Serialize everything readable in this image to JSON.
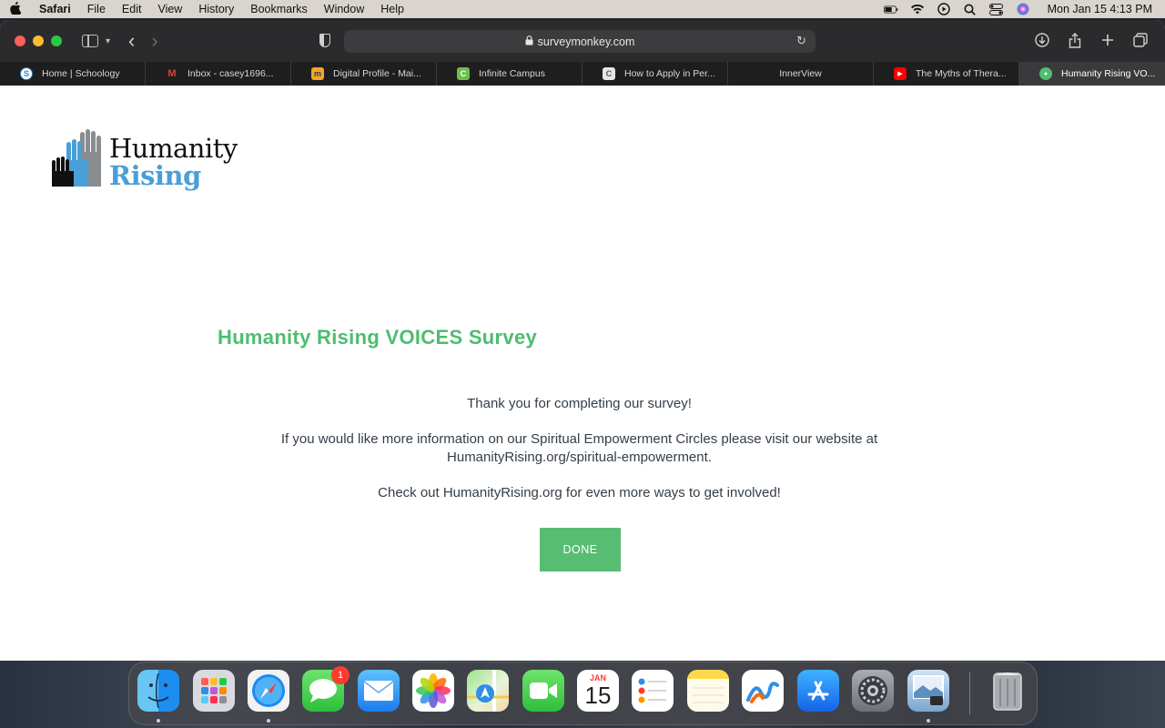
{
  "menubar": {
    "app_name": "Safari",
    "items": [
      "File",
      "Edit",
      "View",
      "History",
      "Bookmarks",
      "Window",
      "Help"
    ],
    "clock": "Mon Jan 15  4:13 PM"
  },
  "browser": {
    "url": "surveymonkey.com",
    "tabs": [
      {
        "label": "Home | Schoology",
        "favicon_text": "S",
        "favicon_color": "#1e84c8"
      },
      {
        "label": "Inbox - casey1696...",
        "favicon_text": "M",
        "favicon_color": "#d44638"
      },
      {
        "label": "Digital Profile - Mai...",
        "favicon_text": "m",
        "favicon_color": "#f5a623"
      },
      {
        "label": "Infinite Campus",
        "favicon_text": "C",
        "favicon_color": "#6cc04a"
      },
      {
        "label": "How to Apply in Per...",
        "favicon_text": "C",
        "favicon_color": "#cccccc"
      },
      {
        "label": "InnerView",
        "favicon_text": "",
        "favicon_color": ""
      },
      {
        "label": "The Myths of Thera...",
        "favicon_text": "▶",
        "favicon_color": "#ff0000"
      },
      {
        "label": "Humanity Rising VO...",
        "favicon_text": "●",
        "favicon_color": "#4ebd6f"
      }
    ]
  },
  "page": {
    "logo_line1": "Humanity",
    "logo_line2": "Rising",
    "survey_title": "Humanity Rising VOICES Survey",
    "thank_you": "Thank you for completing our survey!",
    "info_line1": "If you would like more information on our Spiritual Empowerment Circles please visit our website at",
    "info_line2": "HumanityRising.org/spiritual-empowerment.",
    "check_out": "Check out HumanityRising.org for even more ways to get involved!",
    "done_label": "DONE"
  },
  "dock": {
    "calendar_month": "JAN",
    "calendar_day": "15",
    "messages_badge": "1"
  }
}
